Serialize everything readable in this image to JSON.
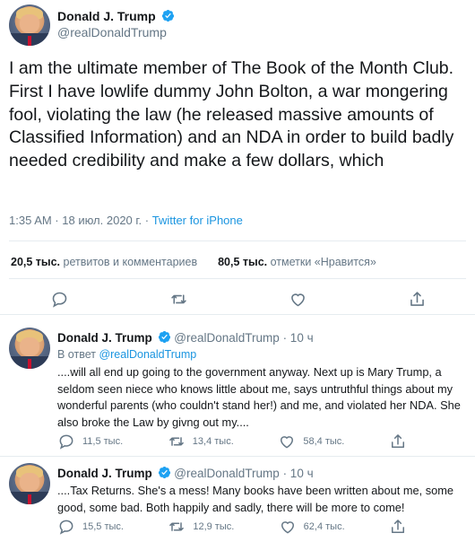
{
  "main_tweet": {
    "author_name": "Donald J. Trump",
    "author_handle": "@realDonaldTrump",
    "text": "I am the ultimate member of The Book of the Month Club. First I have lowlife dummy John Bolton, a war mongering fool, violating the law (he released massive amounts of Classified Information) and an NDA in order to build badly needed credibility and make a few dollars, which",
    "timestamp": "1:35 AM · 18 июл. 2020 г. · ",
    "source": "Twitter for iPhone",
    "retweets_count": "20,5 тыс.",
    "retweets_label": "ретвитов и комментариев",
    "likes_count": "80,5 тыс.",
    "likes_label": "отметки «Нравится»"
  },
  "replies": [
    {
      "author_name": "Donald J. Trump",
      "author_handle": "@realDonaldTrump",
      "time": "· 10 ч",
      "reply_to_prefix": "В ответ ",
      "reply_to_handle": "@realDonaldTrump",
      "text": "....will all end up going to the government anyway. Next up is Mary Trump, a seldom seen niece who knows little about me, says untruthful things about my wonderful parents (who couldn't stand her!) and me, and violated her NDA. She also broke the Law by givng out my....",
      "reply_count": "11,5 тыс.",
      "retweet_count": "13,4 тыс.",
      "like_count": "58,4 тыс."
    },
    {
      "author_name": "Donald J. Trump",
      "author_handle": "@realDonaldTrump",
      "time": "· 10 ч",
      "text": "....Tax Returns. She's a mess! Many books have been written about me, some good, some bad. Both happily and sadly, there will be more to come!",
      "reply_count": "15,5 тыс.",
      "retweet_count": "12,9 тыс.",
      "like_count": "62,4 тыс."
    }
  ],
  "icons": [
    "verified-badge-icon",
    "reply-icon",
    "retweet-icon",
    "like-icon",
    "share-icon"
  ],
  "colors": {
    "accent": "#1da1f2",
    "link": "#1b95e0",
    "muted": "#657786",
    "divider": "#e6ecf0"
  }
}
